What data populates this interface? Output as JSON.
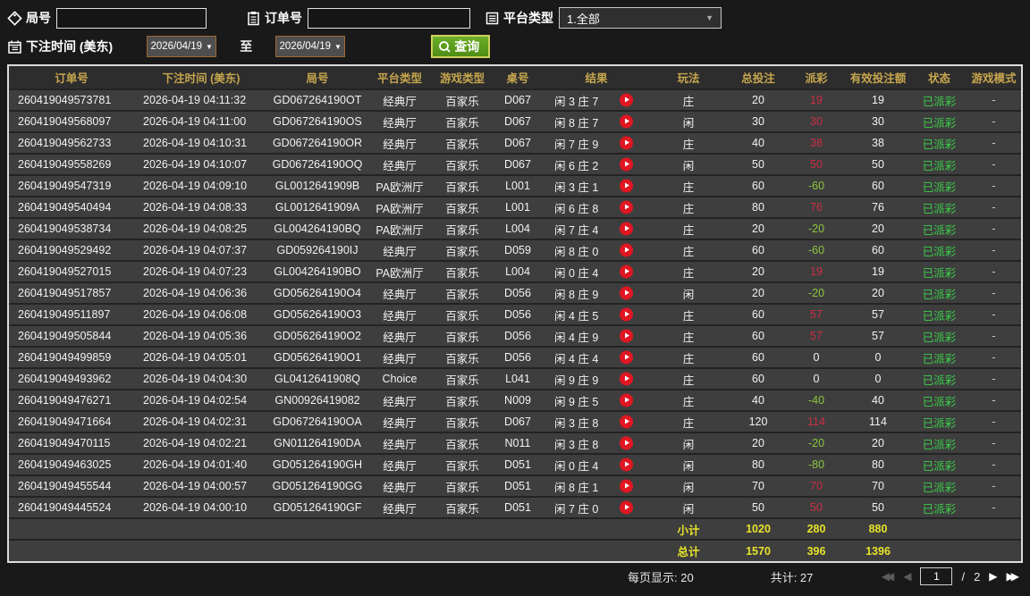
{
  "filters": {
    "game_no_label": "局号",
    "order_no_label": "订单号",
    "platform_label": "平台类型",
    "platform_value": "1.全部",
    "bet_time_label": "下注时间 (美东)",
    "date_from": "2026/04/19",
    "to_label": "至",
    "date_to": "2026/04/19",
    "query_label": "查询"
  },
  "table": {
    "columns": [
      "订单号",
      "下注时间 (美东)",
      "局号",
      "平台类型",
      "游戏类型",
      "桌号",
      "结果",
      "玩法",
      "总投注",
      "派彩",
      "有效投注额",
      "状态",
      "游戏模式"
    ],
    "rows": [
      {
        "order": "260419049573781",
        "time": "2026-04-19 04:11:32",
        "game": "GD067264190OT",
        "platform": "经典厅",
        "gtype": "百家乐",
        "tableno": "D067",
        "result": "闲 3 庄 7",
        "play": "庄",
        "total": "20",
        "payout": "19",
        "valid": "19",
        "status": "已派彩",
        "mode": "-"
      },
      {
        "order": "260419049568097",
        "time": "2026-04-19 04:11:00",
        "game": "GD067264190OS",
        "platform": "经典厅",
        "gtype": "百家乐",
        "tableno": "D067",
        "result": "闲 8 庄 7",
        "play": "闲",
        "total": "30",
        "payout": "30",
        "valid": "30",
        "status": "已派彩",
        "mode": "-"
      },
      {
        "order": "260419049562733",
        "time": "2026-04-19 04:10:31",
        "game": "GD067264190OR",
        "platform": "经典厅",
        "gtype": "百家乐",
        "tableno": "D067",
        "result": "闲 7 庄 9",
        "play": "庄",
        "total": "40",
        "payout": "38",
        "valid": "38",
        "status": "已派彩",
        "mode": "-"
      },
      {
        "order": "260419049558269",
        "time": "2026-04-19 04:10:07",
        "game": "GD067264190OQ",
        "platform": "经典厅",
        "gtype": "百家乐",
        "tableno": "D067",
        "result": "闲 6 庄 2",
        "play": "闲",
        "total": "50",
        "payout": "50",
        "valid": "50",
        "status": "已派彩",
        "mode": "-"
      },
      {
        "order": "260419049547319",
        "time": "2026-04-19 04:09:10",
        "game": "GL0012641909B",
        "platform": "PA欧洲厅",
        "gtype": "百家乐",
        "tableno": "L001",
        "result": "闲 3 庄 1",
        "play": "庄",
        "total": "60",
        "payout": "-60",
        "valid": "60",
        "status": "已派彩",
        "mode": "-"
      },
      {
        "order": "260419049540494",
        "time": "2026-04-19 04:08:33",
        "game": "GL0012641909A",
        "platform": "PA欧洲厅",
        "gtype": "百家乐",
        "tableno": "L001",
        "result": "闲 6 庄 8",
        "play": "庄",
        "total": "80",
        "payout": "76",
        "valid": "76",
        "status": "已派彩",
        "mode": "-"
      },
      {
        "order": "260419049538734",
        "time": "2026-04-19 04:08:25",
        "game": "GL004264190BQ",
        "platform": "PA欧洲厅",
        "gtype": "百家乐",
        "tableno": "L004",
        "result": "闲 7 庄 4",
        "play": "庄",
        "total": "20",
        "payout": "-20",
        "valid": "20",
        "status": "已派彩",
        "mode": "-"
      },
      {
        "order": "260419049529492",
        "time": "2026-04-19 04:07:37",
        "game": "GD059264190IJ",
        "platform": "经典厅",
        "gtype": "百家乐",
        "tableno": "D059",
        "result": "闲 8 庄 0",
        "play": "庄",
        "total": "60",
        "payout": "-60",
        "valid": "60",
        "status": "已派彩",
        "mode": "-"
      },
      {
        "order": "260419049527015",
        "time": "2026-04-19 04:07:23",
        "game": "GL004264190BO",
        "platform": "PA欧洲厅",
        "gtype": "百家乐",
        "tableno": "L004",
        "result": "闲 0 庄 4",
        "play": "庄",
        "total": "20",
        "payout": "19",
        "valid": "19",
        "status": "已派彩",
        "mode": "-"
      },
      {
        "order": "260419049517857",
        "time": "2026-04-19 04:06:36",
        "game": "GD056264190O4",
        "platform": "经典厅",
        "gtype": "百家乐",
        "tableno": "D056",
        "result": "闲 8 庄 9",
        "play": "闲",
        "total": "20",
        "payout": "-20",
        "valid": "20",
        "status": "已派彩",
        "mode": "-"
      },
      {
        "order": "260419049511897",
        "time": "2026-04-19 04:06:08",
        "game": "GD056264190O3",
        "platform": "经典厅",
        "gtype": "百家乐",
        "tableno": "D056",
        "result": "闲 4 庄 5",
        "play": "庄",
        "total": "60",
        "payout": "57",
        "valid": "57",
        "status": "已派彩",
        "mode": "-"
      },
      {
        "order": "260419049505844",
        "time": "2026-04-19 04:05:36",
        "game": "GD056264190O2",
        "platform": "经典厅",
        "gtype": "百家乐",
        "tableno": "D056",
        "result": "闲 4 庄 9",
        "play": "庄",
        "total": "60",
        "payout": "57",
        "valid": "57",
        "status": "已派彩",
        "mode": "-"
      },
      {
        "order": "260419049499859",
        "time": "2026-04-19 04:05:01",
        "game": "GD056264190O1",
        "platform": "经典厅",
        "gtype": "百家乐",
        "tableno": "D056",
        "result": "闲 4 庄 4",
        "play": "庄",
        "total": "60",
        "payout": "0",
        "valid": "0",
        "status": "已派彩",
        "mode": "-"
      },
      {
        "order": "260419049493962",
        "time": "2026-04-19 04:04:30",
        "game": "GL0412641908Q",
        "platform": "Choice",
        "gtype": "百家乐",
        "tableno": "L041",
        "result": "闲 9 庄 9",
        "play": "庄",
        "total": "60",
        "payout": "0",
        "valid": "0",
        "status": "已派彩",
        "mode": "-"
      },
      {
        "order": "260419049476271",
        "time": "2026-04-19 04:02:54",
        "game": "GN00926419082",
        "platform": "经典厅",
        "gtype": "百家乐",
        "tableno": "N009",
        "result": "闲 9 庄 5",
        "play": "庄",
        "total": "40",
        "payout": "-40",
        "valid": "40",
        "status": "已派彩",
        "mode": "-"
      },
      {
        "order": "260419049471664",
        "time": "2026-04-19 04:02:31",
        "game": "GD067264190OA",
        "platform": "经典厅",
        "gtype": "百家乐",
        "tableno": "D067",
        "result": "闲 3 庄 8",
        "play": "庄",
        "total": "120",
        "payout": "114",
        "valid": "114",
        "status": "已派彩",
        "mode": "-"
      },
      {
        "order": "260419049470115",
        "time": "2026-04-19 04:02:21",
        "game": "GN011264190DA",
        "platform": "经典厅",
        "gtype": "百家乐",
        "tableno": "N011",
        "result": "闲 3 庄 8",
        "play": "闲",
        "total": "20",
        "payout": "-20",
        "valid": "20",
        "status": "已派彩",
        "mode": "-"
      },
      {
        "order": "260419049463025",
        "time": "2026-04-19 04:01:40",
        "game": "GD051264190GH",
        "platform": "经典厅",
        "gtype": "百家乐",
        "tableno": "D051",
        "result": "闲 0 庄 4",
        "play": "闲",
        "total": "80",
        "payout": "-80",
        "valid": "80",
        "status": "已派彩",
        "mode": "-"
      },
      {
        "order": "260419049455544",
        "time": "2026-04-19 04:00:57",
        "game": "GD051264190GG",
        "platform": "经典厅",
        "gtype": "百家乐",
        "tableno": "D051",
        "result": "闲 8 庄 1",
        "play": "闲",
        "total": "70",
        "payout": "70",
        "valid": "70",
        "status": "已派彩",
        "mode": "-"
      },
      {
        "order": "260419049445524",
        "time": "2026-04-19 04:00:10",
        "game": "GD051264190GF",
        "platform": "经典厅",
        "gtype": "百家乐",
        "tableno": "D051",
        "result": "闲 7 庄 0",
        "play": "闲",
        "total": "50",
        "payout": "50",
        "valid": "50",
        "status": "已派彩",
        "mode": "-"
      }
    ],
    "subtotal": {
      "label": "小计",
      "total_bet": "1020",
      "payout": "280",
      "valid_bet": "880"
    },
    "total": {
      "label": "总计",
      "total_bet": "1570",
      "payout": "396",
      "valid_bet": "1396"
    }
  },
  "footer": {
    "per_page": "每页显示: 20",
    "total_count": "共计: 27",
    "page": "1",
    "page_sep": "/",
    "total_pages": "2"
  },
  "colors": {
    "header_gold": "#c7a64e",
    "payout_positive_red": "#cc2e44",
    "payout_negative_green": "#8dc63f",
    "status_paid_green": "#3bcf4a",
    "totals_yellow": "#e6e32a",
    "query_button_green": "#5f9d1d",
    "play_icon_red": "#e01622"
  }
}
